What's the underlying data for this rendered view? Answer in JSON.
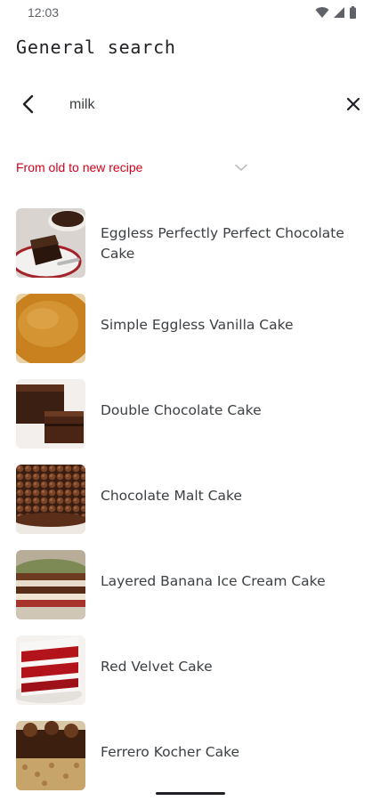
{
  "status_bar": {
    "time": "12:03",
    "icons": [
      "wifi-icon",
      "signal-icon",
      "battery-icon"
    ]
  },
  "header": {
    "title": "General search"
  },
  "search": {
    "value": "milk",
    "back_icon": "chevron-left-icon",
    "clear_icon": "close-icon"
  },
  "sort": {
    "selected": "From old to new recipe",
    "icon": "chevron-down-icon",
    "color": "#d0021b"
  },
  "recipes": [
    {
      "title": "Eggless Perfectly Perfect Chocolate Cake"
    },
    {
      "title": "Simple Eggless Vanilla Cake"
    },
    {
      "title": "Double Chocolate Cake"
    },
    {
      "title": "Chocolate Malt Cake"
    },
    {
      "title": "Layered Banana Ice Cream Cake"
    },
    {
      "title": "Red Velvet Cake"
    },
    {
      "title": "Ferrero Kocher Cake"
    }
  ]
}
